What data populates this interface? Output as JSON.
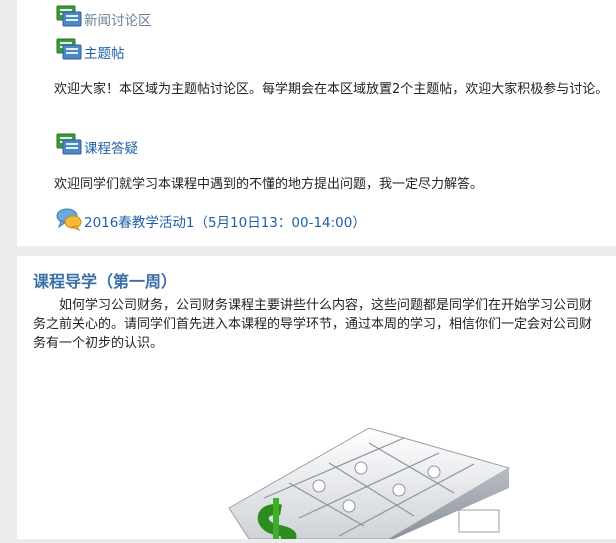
{
  "forum_items": [
    {
      "label": "新闻讨论区",
      "icon": "forum-icon",
      "muted": true
    },
    {
      "label": "主题帖",
      "icon": "forum-icon",
      "muted": false,
      "description": "欢迎大家！本区域为主题帖讨论区。每学期会在本区域放置2个主题帖，欢迎大家积极参与讨论。"
    },
    {
      "label": "课程答疑",
      "icon": "forum-icon",
      "muted": false,
      "description": "欢迎同学们就学习本课程中遇到的不懂的地方提出问题，我一定尽力解答。"
    }
  ],
  "chat_item": {
    "label": "2016春教学活动1（5月10日13：00-14:00）",
    "icon": "chat-bubble-icon"
  },
  "section": {
    "title": "课程导学（第一周）",
    "body": "如何学习公司财务，公司财务课程主要讲些什么内容，这些问题都是同学们在开始学习公司财务之前关心的。请同学们首先进入本课程的导学环节，通过本周的学习，相信你们一定会对公司财务有一个初步的认识。"
  },
  "colors": {
    "link": "#1f5fa8",
    "title": "#3a6fa6",
    "background": "#ececec"
  }
}
